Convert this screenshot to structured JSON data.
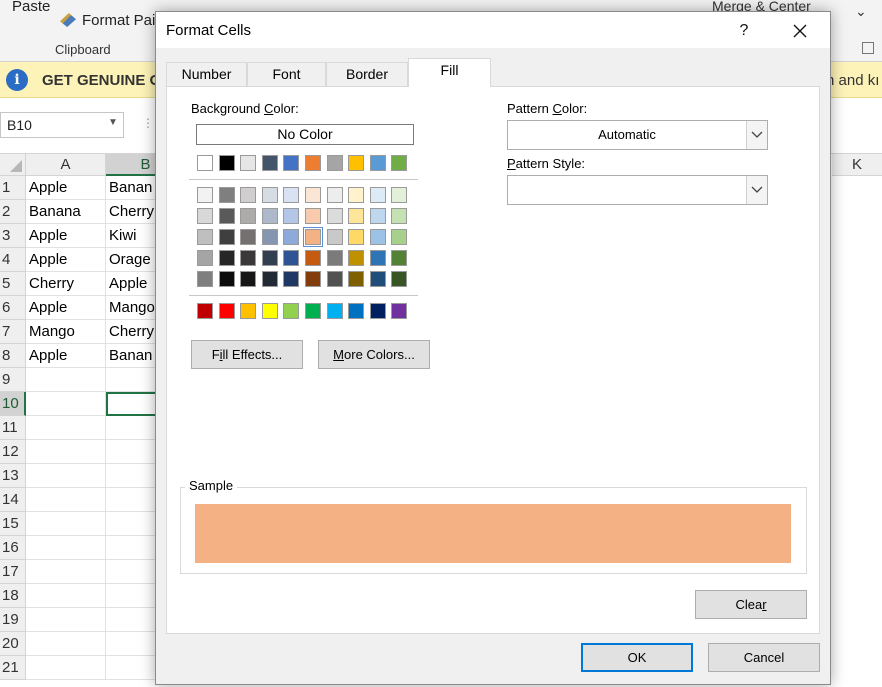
{
  "ribbon": {
    "paste_label": "Paste",
    "format_painter_label": "Format Pain",
    "clipboard_group": "Clipboard",
    "merge_label": "Merge & Center"
  },
  "message_bar": {
    "text": "GET GENUINE OI",
    "right_text": "n and kı"
  },
  "name_box": {
    "value": "B10"
  },
  "sheet": {
    "columns": [
      "A",
      "B",
      "K"
    ],
    "rows": [
      "1",
      "2",
      "3",
      "4",
      "5",
      "6",
      "7",
      "8",
      "9",
      "10",
      "11",
      "12",
      "13",
      "14",
      "15",
      "16",
      "17",
      "18",
      "19",
      "20",
      "21"
    ],
    "colA": [
      "Apple",
      "Banana",
      "Apple",
      "Apple",
      "Cherry",
      "Apple",
      "Mango",
      "Apple",
      "",
      "",
      "",
      "",
      "",
      "",
      "",
      "",
      "",
      "",
      "",
      "",
      ""
    ],
    "colB": [
      "Banan",
      "Cherry",
      "Kiwi",
      "Orage",
      "Apple",
      "Mango",
      "Cherry",
      "Banan",
      "",
      "",
      "",
      "",
      "",
      "",
      "",
      "",
      "",
      "",
      "",
      "",
      ""
    ]
  },
  "dialog": {
    "title": "Format Cells",
    "help_label": "?",
    "tabs": [
      "Number",
      "Font",
      "Border",
      "Fill"
    ],
    "active_tab": "Fill",
    "background_color_label": "Background Color:",
    "no_color_label": "No Color",
    "theme_colors": [
      [
        "#ffffff",
        "#000000",
        "#e7e6e6",
        "#44546a",
        "#4472c4",
        "#ed7d31",
        "#a5a5a5",
        "#ffc000",
        "#5b9bd5",
        "#70ad47"
      ],
      [
        "#f2f2f2",
        "#7f7f7f",
        "#d0cece",
        "#d6dce4",
        "#d9e2f3",
        "#fbe5d5",
        "#ededed",
        "#fff2cc",
        "#ddebf7",
        "#e2efd9"
      ],
      [
        "#d8d8d8",
        "#595959",
        "#aeabab",
        "#adb9ca",
        "#b4c6e7",
        "#f7cbac",
        "#dbdbdb",
        "#fee599",
        "#bdd7ee",
        "#c5e0b3"
      ],
      [
        "#bfbfbf",
        "#3f3f3f",
        "#757070",
        "#8496b0",
        "#8eaadb",
        "#f4b183",
        "#c9c9c9",
        "#ffd965",
        "#9cc3e5",
        "#a8d08d"
      ],
      [
        "#a5a5a5",
        "#262626",
        "#3a3838",
        "#323f4f",
        "#2f5496",
        "#c55a11",
        "#7b7b7b",
        "#bf9000",
        "#2e75b5",
        "#538135"
      ],
      [
        "#7f7f7f",
        "#0c0c0c",
        "#171616",
        "#222a35",
        "#1f3864",
        "#833c0b",
        "#525252",
        "#7f6000",
        "#1e4e79",
        "#375623"
      ]
    ],
    "standard_colors": [
      "#c00000",
      "#ff0000",
      "#ffc000",
      "#ffff00",
      "#92d050",
      "#00b050",
      "#00b0f0",
      "#0070c0",
      "#002060",
      "#7030a0"
    ],
    "selected_color": "#f4b183",
    "fill_effects_label": "Fill Effects...",
    "more_colors_label": "More Colors...",
    "pattern_color_label": "Pattern Color:",
    "pattern_color_value": "Automatic",
    "pattern_style_label": "Pattern Style:",
    "pattern_style_value": "",
    "sample_label": "Sample",
    "sample_color": "#f4b183",
    "clear_label": "Clear",
    "ok_label": "OK",
    "cancel_label": "Cancel"
  }
}
